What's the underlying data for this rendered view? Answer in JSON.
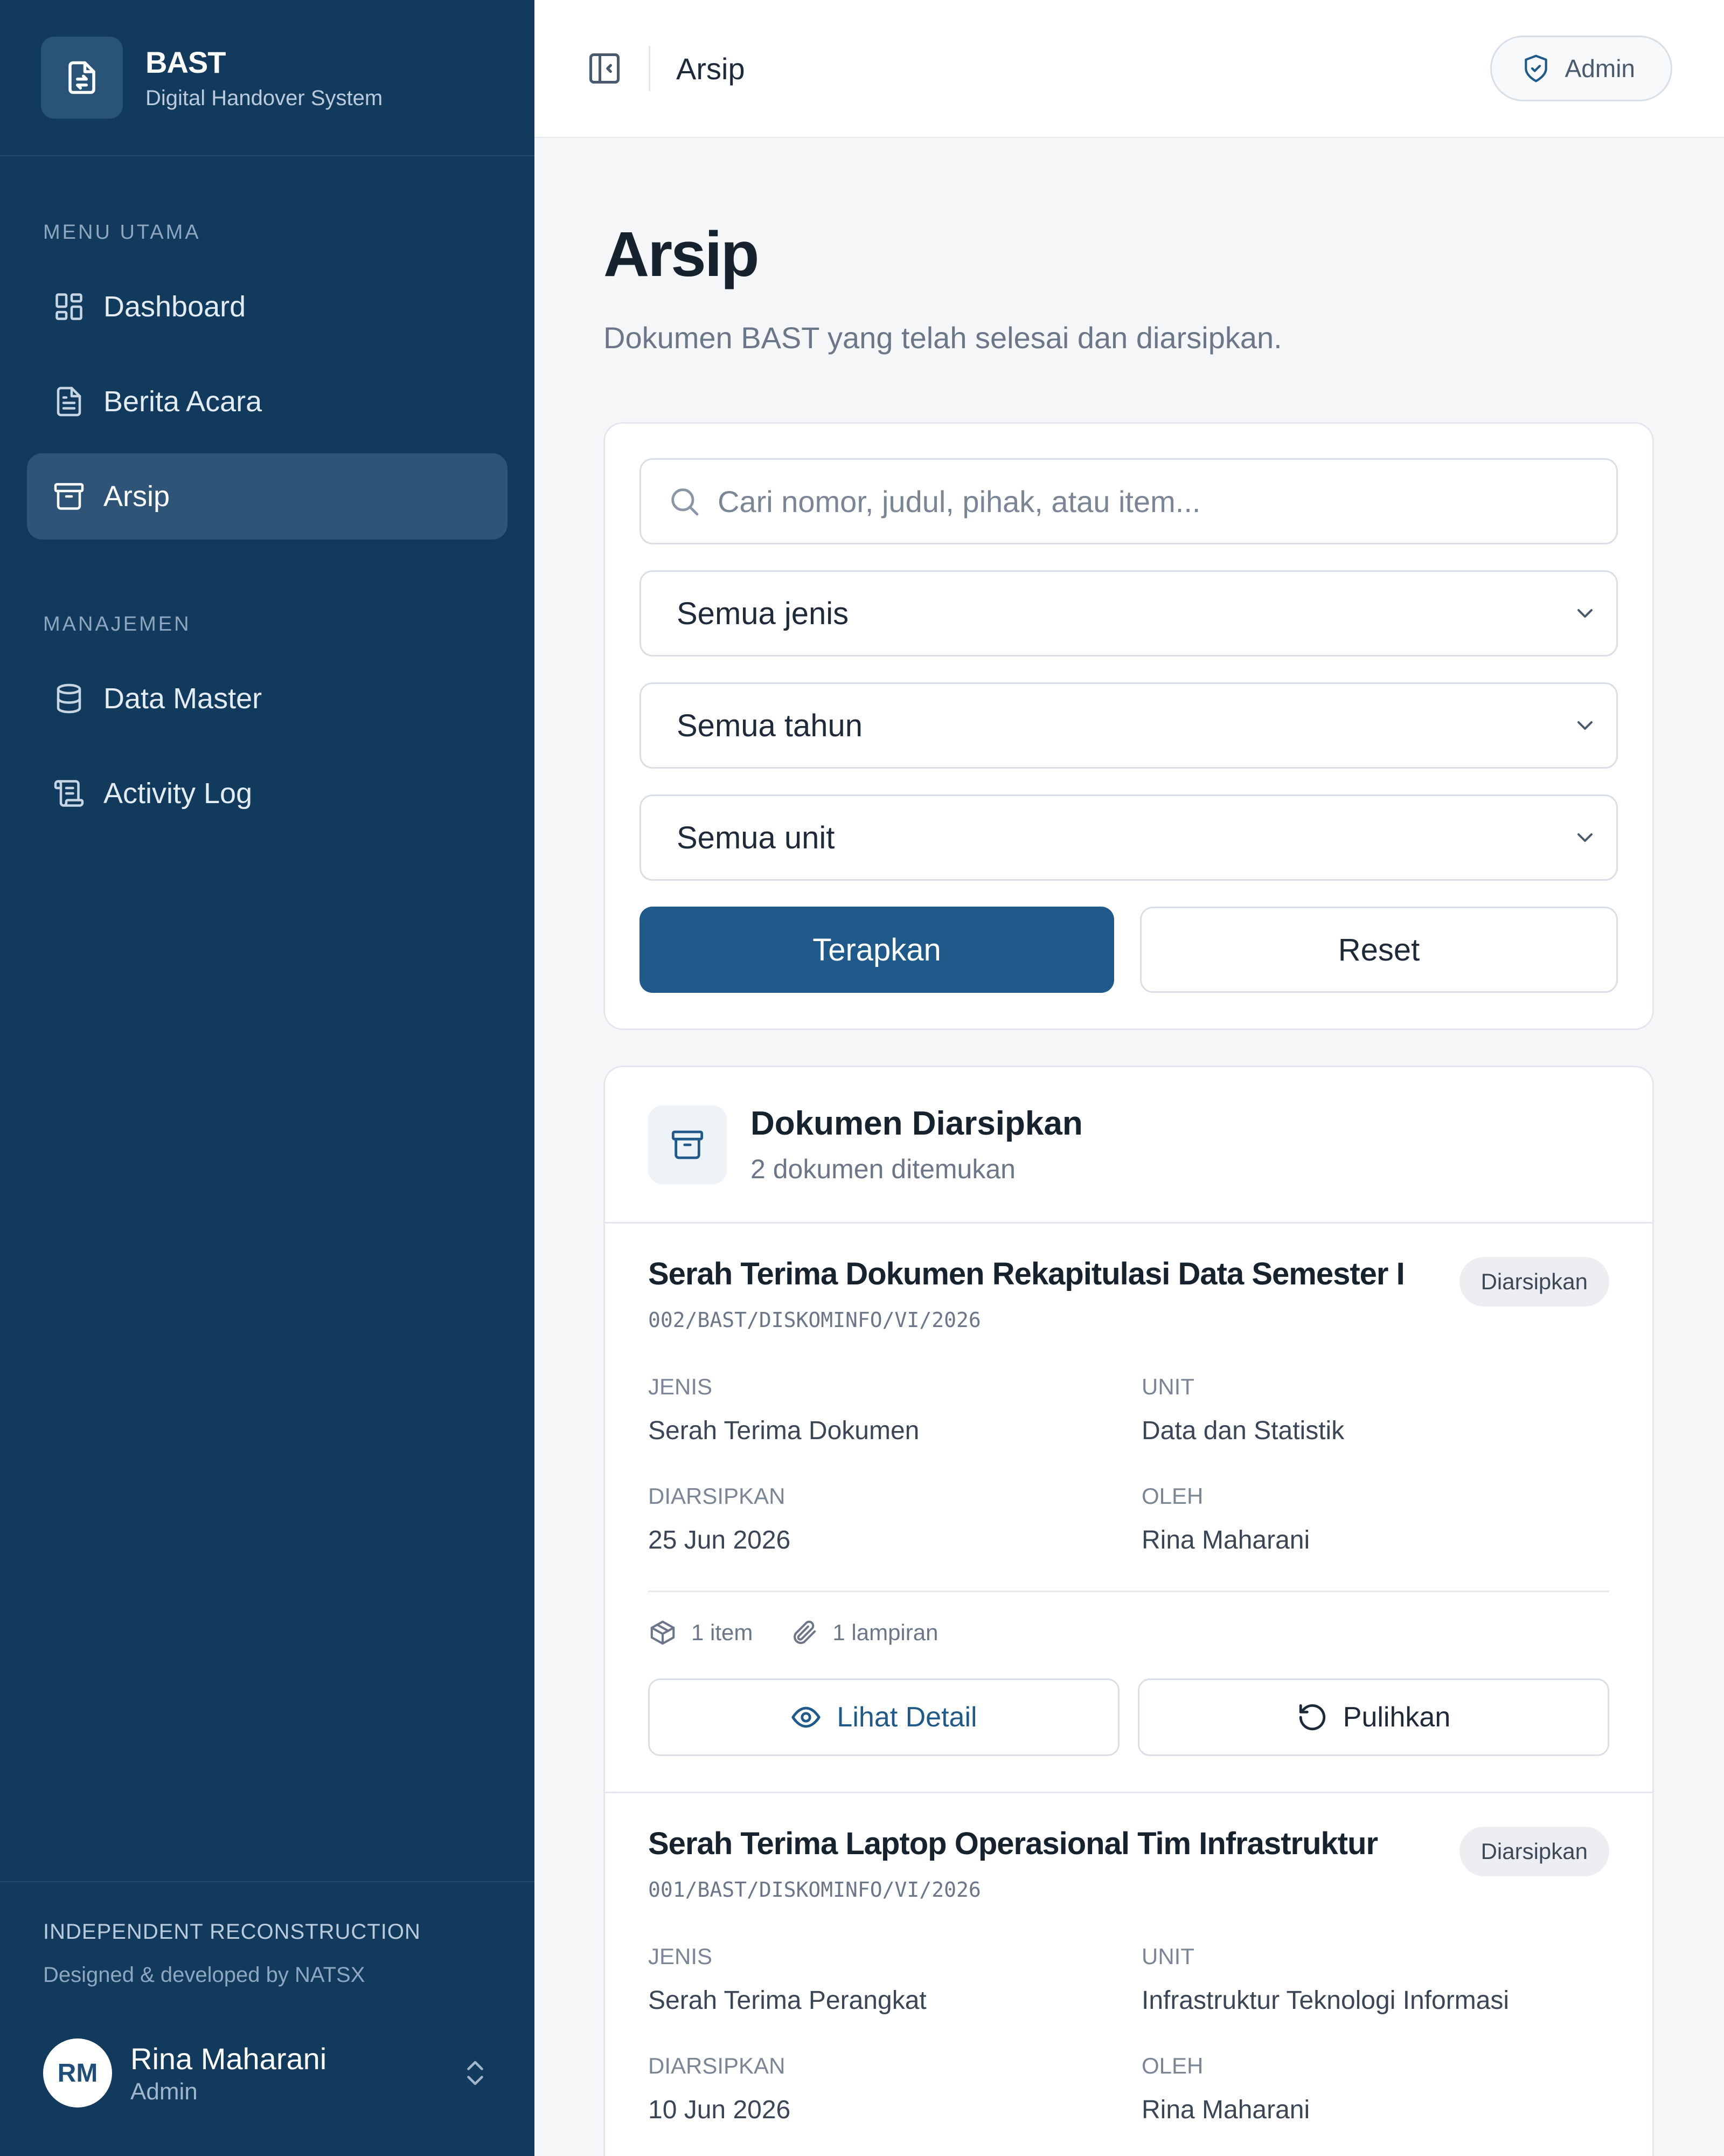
{
  "brand": {
    "title": "BAST",
    "subtitle": "Digital Handover System"
  },
  "sidebar": {
    "section_main": "MENU UTAMA",
    "section_manage": "MANAJEMEN",
    "items": [
      {
        "label": "Dashboard",
        "icon": "dashboard-icon"
      },
      {
        "label": "Berita Acara",
        "icon": "document-icon"
      },
      {
        "label": "Arsip",
        "icon": "archive-icon",
        "active": true
      },
      {
        "label": "Data Master",
        "icon": "database-icon"
      },
      {
        "label": "Activity Log",
        "icon": "scroll-icon"
      }
    ],
    "footer": {
      "credit_title": "INDEPENDENT RECONSTRUCTION",
      "credit_sub": "Designed & developed by NATSX",
      "user_initials": "RM",
      "user_name": "Rina Maharani",
      "user_role": "Admin"
    }
  },
  "topbar": {
    "title": "Arsip",
    "role_label": "Admin"
  },
  "page": {
    "title": "Arsip",
    "subtitle": "Dokumen BAST yang telah selesai dan diarsipkan."
  },
  "filters": {
    "search_placeholder": "Cari nomor, judul, pihak, atau item...",
    "type_selected": "Semua jenis",
    "year_selected": "Semua tahun",
    "unit_selected": "Semua unit",
    "apply_label": "Terapkan",
    "reset_label": "Reset"
  },
  "list": {
    "title": "Dokumen Diarsipkan",
    "count_text": "2 dokumen ditemukan",
    "labels": {
      "type": "JENIS",
      "unit": "UNIT",
      "archived": "DIARSIPKAN",
      "by": "OLEH"
    },
    "detail_label": "Lihat Detail",
    "restore_label": "Pulihkan",
    "documents": [
      {
        "title": "Serah Terima Dokumen Rekapitulasi Data Semester I",
        "number": "002/BAST/DISKOMINFO/VI/2026",
        "status": "Diarsipkan",
        "type": "Serah Terima Dokumen",
        "unit": "Data dan Statistik",
        "archived": "25 Jun 2026",
        "by": "Rina Maharani",
        "items": "1 item",
        "attachments": "1 lampiran"
      },
      {
        "title": "Serah Terima Laptop Operasional Tim Infrastruktur",
        "number": "001/BAST/DISKOMINFO/VI/2026",
        "status": "Diarsipkan",
        "type": "Serah Terima Perangkat",
        "unit": "Infrastruktur Teknologi Informasi",
        "archived": "10 Jun 2026",
        "by": "Rina Maharani"
      }
    ]
  },
  "colors": {
    "sidebar": "#123a5c",
    "primary": "#1f5a8a",
    "active_item": "#2e5478"
  }
}
